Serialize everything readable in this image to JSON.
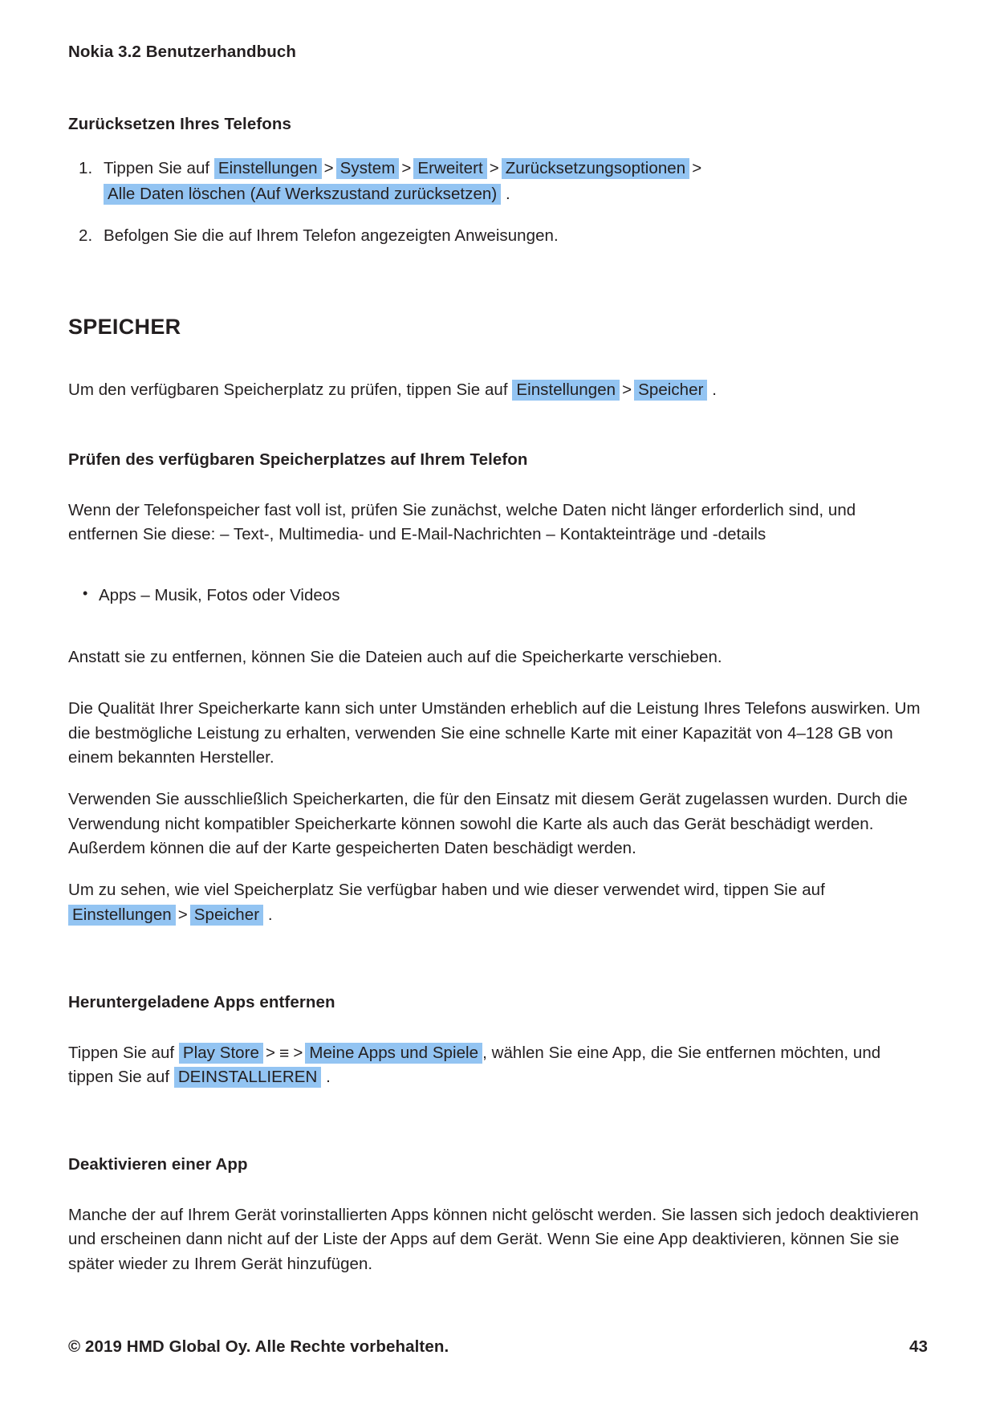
{
  "document": {
    "running_head": "Nokia 3.2 Benutzerhandbuch",
    "footer_copyright": "© 2019 HMD Global Oy. Alle Rechte vorbehalten.",
    "page_number": "43"
  },
  "colors": {
    "highlight": "#93c4f2",
    "text": "#231f20",
    "background": "#ffffff"
  },
  "sections": {
    "reset_phone": {
      "heading": "Zurücksetzen Ihres Telefons",
      "step1": {
        "lead": "Tippen Sie auf",
        "path": [
          "Einstellungen",
          "System",
          "Erweitert",
          "Zurücksetzungsoptionen",
          "Alle Daten löschen (Auf Werkszustand zurücksetzen)"
        ],
        "separator": ">",
        "trailing": "."
      },
      "step2": "Befolgen Sie die auf Ihrem Telefon angezeigten Anweisungen."
    },
    "storage": {
      "heading": "SPEICHER",
      "intro": {
        "lead": "Um den verfügbaren Speicherplatz zu prüfen, tippen Sie auf",
        "path": [
          "Einstellungen",
          "Speicher"
        ],
        "separator": ">",
        "trailing": "."
      }
    },
    "check_storage": {
      "heading": "Prüfen des verfügbaren Speicherplatzes auf Ihrem Telefon",
      "paragraph": "Wenn der Telefonspeicher fast voll ist, prüfen Sie zunächst, welche Daten nicht länger erforderlich sind, und entfernen Sie diese: – Text-, Multimedia- und E-Mail-Nachrichten – Kontakteinträge und -details",
      "bullets": [
        "Apps – Musik, Fotos oder Videos"
      ],
      "paragraph2": "Anstatt sie zu entfernen, können Sie die Dateien auch auf die Speicherkarte verschieben.",
      "paragraph3": "Die Qualität Ihrer Speicherkarte kann sich unter Umständen erheblich auf die Leistung Ihres Telefons auswirken. Um die bestmögliche Leistung zu erhalten, verwenden Sie eine schnelle Karte mit einer Kapazität von 4–128 GB von einem bekannten Hersteller.",
      "paragraph4": "Verwenden Sie ausschließlich Speicherkarten, die für den Einsatz mit diesem Gerät zugelassen wurden. Durch die Verwendung nicht kompatibler Speicherkarte können sowohl die Karte als auch das Gerät beschädigt werden. Außerdem können die auf der Karte gespeicherten Daten beschädigt werden.",
      "paragraph5": {
        "lead": "Um zu sehen, wie viel Speicherplatz Sie verfügbar haben und wie dieser verwendet wird, tippen Sie auf",
        "path": [
          "Einstellungen",
          "Speicher"
        ],
        "separator": ">",
        "trailing": "."
      }
    },
    "remove_apps": {
      "heading": "Heruntergeladene Apps entfernen",
      "instruction": {
        "lead": "Tippen Sie auf",
        "item1": "Play Store",
        "separator": ">",
        "menu_icon": "≡",
        "item2": "Meine Apps und Spiele",
        "middle": ", wählen Sie eine App, die Sie entfernen möchten, und tippen Sie auf",
        "item3": "DEINSTALLIEREN",
        "trailing": "."
      }
    },
    "disable_app": {
      "heading": "Deaktivieren einer App",
      "paragraph": "Manche der auf Ihrem Gerät vorinstallierten Apps können nicht gelöscht werden. Sie lassen sich jedoch deaktivieren und erscheinen dann nicht auf der Liste der Apps auf dem Gerät. Wenn Sie eine App deaktivieren, können Sie sie später wieder zu Ihrem Gerät hinzufügen."
    }
  }
}
